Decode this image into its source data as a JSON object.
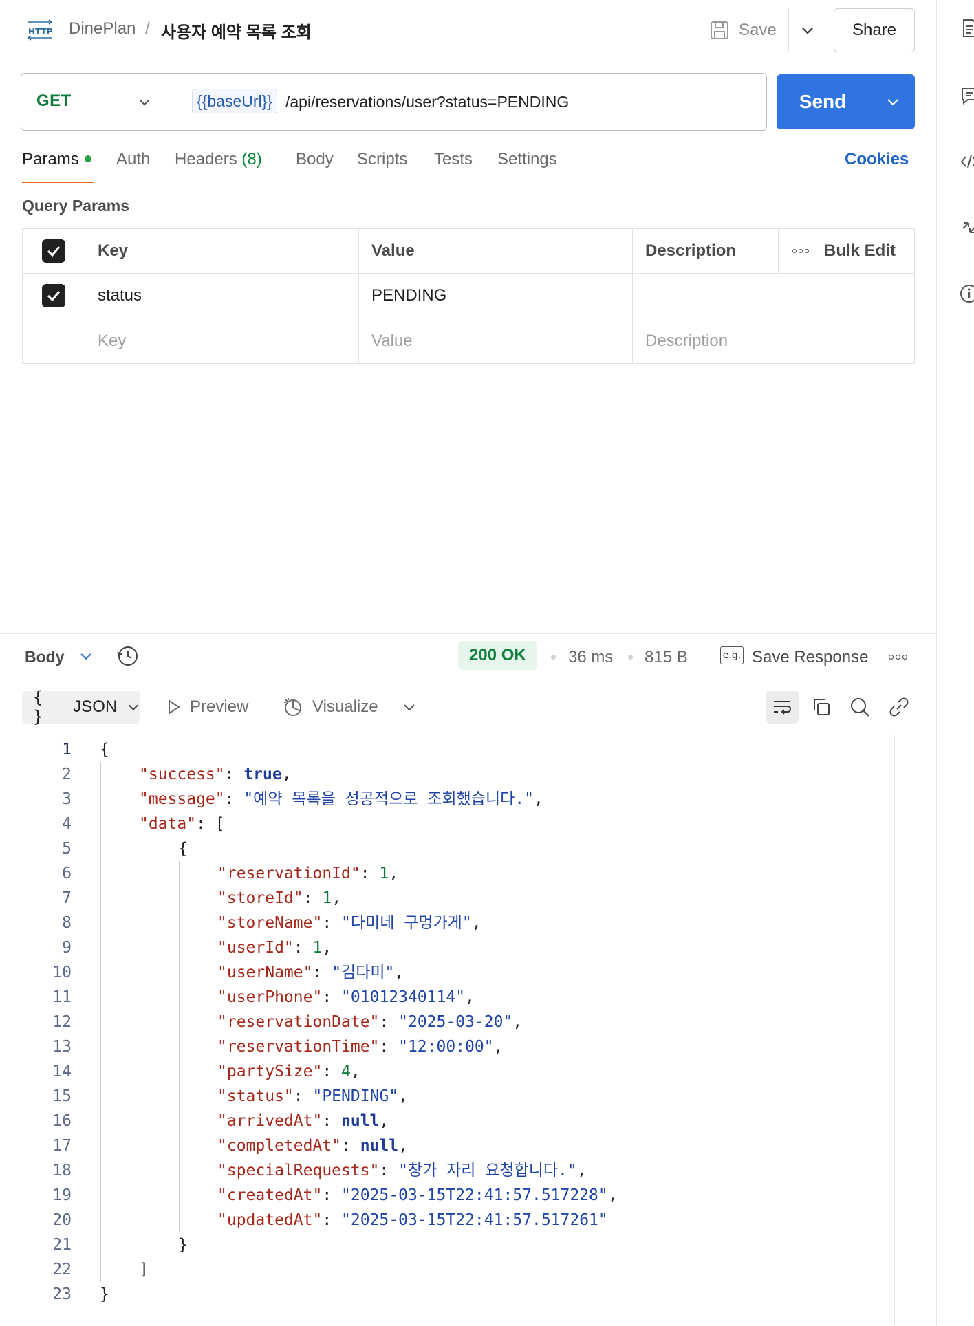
{
  "header": {
    "workspace": "DinePlan",
    "separator": "/",
    "request_name": "사용자 예약 목록 조회",
    "save_label": "Save",
    "share_label": "Share"
  },
  "request": {
    "method": "GET",
    "url_variable": "{{baseUrl}}",
    "url_path": "/api/reservations/user?status=PENDING",
    "send_label": "Send"
  },
  "tabs": {
    "params": "Params",
    "auth": "Auth",
    "headers": "Headers",
    "headers_count": "(8)",
    "body": "Body",
    "scripts": "Scripts",
    "tests": "Tests",
    "settings": "Settings",
    "cookies": "Cookies"
  },
  "query_params": {
    "section_label": "Query Params",
    "columns": {
      "key": "Key",
      "value": "Value",
      "description": "Description",
      "bulk_edit": "Bulk Edit"
    },
    "rows": [
      {
        "checked": true,
        "key": "status",
        "value": "PENDING",
        "description": ""
      }
    ],
    "placeholders": {
      "key": "Key",
      "value": "Value",
      "description": "Description"
    }
  },
  "response": {
    "body_label": "Body",
    "status": "200 OK",
    "time": "36 ms",
    "size": "815 B",
    "eg_label": "e.g.",
    "save_response": "Save Response",
    "format": "JSON",
    "format_braces": "{ }",
    "preview": "Preview",
    "visualize": "Visualize"
  },
  "code_lines": [
    {
      "n": "1",
      "indent": 0,
      "parts": [
        [
          "p",
          "{"
        ]
      ]
    },
    {
      "n": "2",
      "indent": 1,
      "parts": [
        [
          "k",
          "\"success\""
        ],
        [
          "p",
          ": "
        ],
        [
          "b",
          "true"
        ],
        [
          "p",
          ","
        ]
      ]
    },
    {
      "n": "3",
      "indent": 1,
      "parts": [
        [
          "k",
          "\"message\""
        ],
        [
          "p",
          ": "
        ],
        [
          "s",
          "\"예약 목록을 성공적으로 조회했습니다.\""
        ],
        [
          "p",
          ","
        ]
      ]
    },
    {
      "n": "4",
      "indent": 1,
      "parts": [
        [
          "k",
          "\"data\""
        ],
        [
          "p",
          ": ["
        ]
      ]
    },
    {
      "n": "5",
      "indent": 2,
      "parts": [
        [
          "p",
          "{"
        ]
      ]
    },
    {
      "n": "6",
      "indent": 3,
      "parts": [
        [
          "k",
          "\"reservationId\""
        ],
        [
          "p",
          ": "
        ],
        [
          "n",
          "1"
        ],
        [
          "p",
          ","
        ]
      ]
    },
    {
      "n": "7",
      "indent": 3,
      "parts": [
        [
          "k",
          "\"storeId\""
        ],
        [
          "p",
          ": "
        ],
        [
          "n",
          "1"
        ],
        [
          "p",
          ","
        ]
      ]
    },
    {
      "n": "8",
      "indent": 3,
      "parts": [
        [
          "k",
          "\"storeName\""
        ],
        [
          "p",
          ": "
        ],
        [
          "s",
          "\"다미네 구멍가게\""
        ],
        [
          "p",
          ","
        ]
      ]
    },
    {
      "n": "9",
      "indent": 3,
      "parts": [
        [
          "k",
          "\"userId\""
        ],
        [
          "p",
          ": "
        ],
        [
          "n",
          "1"
        ],
        [
          "p",
          ","
        ]
      ]
    },
    {
      "n": "10",
      "indent": 3,
      "parts": [
        [
          "k",
          "\"userName\""
        ],
        [
          "p",
          ": "
        ],
        [
          "s",
          "\"김다미\""
        ],
        [
          "p",
          ","
        ]
      ]
    },
    {
      "n": "11",
      "indent": 3,
      "parts": [
        [
          "k",
          "\"userPhone\""
        ],
        [
          "p",
          ": "
        ],
        [
          "s",
          "\"01012340114\""
        ],
        [
          "p",
          ","
        ]
      ]
    },
    {
      "n": "12",
      "indent": 3,
      "parts": [
        [
          "k",
          "\"reservationDate\""
        ],
        [
          "p",
          ": "
        ],
        [
          "s",
          "\"2025-03-20\""
        ],
        [
          "p",
          ","
        ]
      ]
    },
    {
      "n": "13",
      "indent": 3,
      "parts": [
        [
          "k",
          "\"reservationTime\""
        ],
        [
          "p",
          ": "
        ],
        [
          "s",
          "\"12:00:00\""
        ],
        [
          "p",
          ","
        ]
      ]
    },
    {
      "n": "14",
      "indent": 3,
      "parts": [
        [
          "k",
          "\"partySize\""
        ],
        [
          "p",
          ": "
        ],
        [
          "n",
          "4"
        ],
        [
          "p",
          ","
        ]
      ]
    },
    {
      "n": "15",
      "indent": 3,
      "parts": [
        [
          "k",
          "\"status\""
        ],
        [
          "p",
          ": "
        ],
        [
          "s",
          "\"PENDING\""
        ],
        [
          "p",
          ","
        ]
      ]
    },
    {
      "n": "16",
      "indent": 3,
      "parts": [
        [
          "k",
          "\"arrivedAt\""
        ],
        [
          "p",
          ": "
        ],
        [
          "b",
          "null"
        ],
        [
          "p",
          ","
        ]
      ]
    },
    {
      "n": "17",
      "indent": 3,
      "parts": [
        [
          "k",
          "\"completedAt\""
        ],
        [
          "p",
          ": "
        ],
        [
          "b",
          "null"
        ],
        [
          "p",
          ","
        ]
      ]
    },
    {
      "n": "18",
      "indent": 3,
      "parts": [
        [
          "k",
          "\"specialRequests\""
        ],
        [
          "p",
          ": "
        ],
        [
          "s",
          "\"창가 자리 요청합니다.\""
        ],
        [
          "p",
          ","
        ]
      ]
    },
    {
      "n": "19",
      "indent": 3,
      "parts": [
        [
          "k",
          "\"createdAt\""
        ],
        [
          "p",
          ": "
        ],
        [
          "s",
          "\"2025-03-15T22:41:57.517228\""
        ],
        [
          "p",
          ","
        ]
      ]
    },
    {
      "n": "20",
      "indent": 3,
      "parts": [
        [
          "k",
          "\"updatedAt\""
        ],
        [
          "p",
          ": "
        ],
        [
          "s",
          "\"2025-03-15T22:41:57.517261\""
        ]
      ]
    },
    {
      "n": "21",
      "indent": 2,
      "parts": [
        [
          "p",
          "}"
        ]
      ]
    },
    {
      "n": "22",
      "indent": 1,
      "parts": [
        [
          "p",
          "]"
        ]
      ]
    },
    {
      "n": "23",
      "indent": 0,
      "parts": [
        [
          "p",
          "}"
        ]
      ]
    }
  ]
}
